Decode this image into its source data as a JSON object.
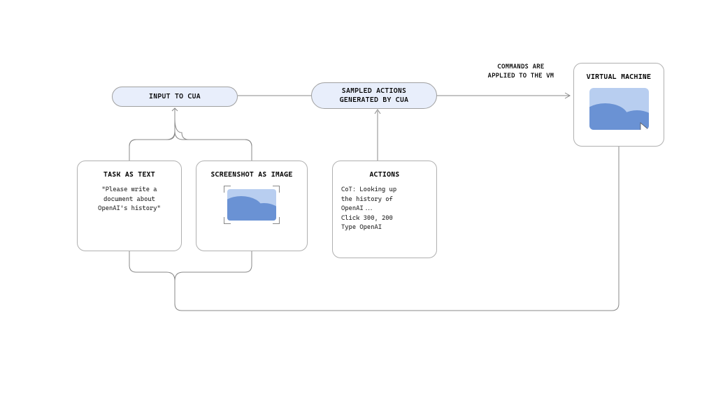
{
  "pills": {
    "input": "INPUT TO CUA",
    "sampled": "SAMPLED ACTIONS\nGENERATED BY CUA"
  },
  "boxes": {
    "task": {
      "title": "TASK AS TEXT",
      "body": "\"Please write a\ndocument about\nOpenAI's history\""
    },
    "screenshot": {
      "title": "SCREENSHOT AS IMAGE"
    },
    "actions": {
      "title": "ACTIONS",
      "body": "CoT: Looking up\nthe history of\nOpenAI...\nClick 300, 200\nType OpenAI"
    },
    "vm": {
      "title": "VIRTUAL MACHINE"
    }
  },
  "labels": {
    "commands": "COMMANDS ARE\nAPPLIED TO THE VM"
  }
}
